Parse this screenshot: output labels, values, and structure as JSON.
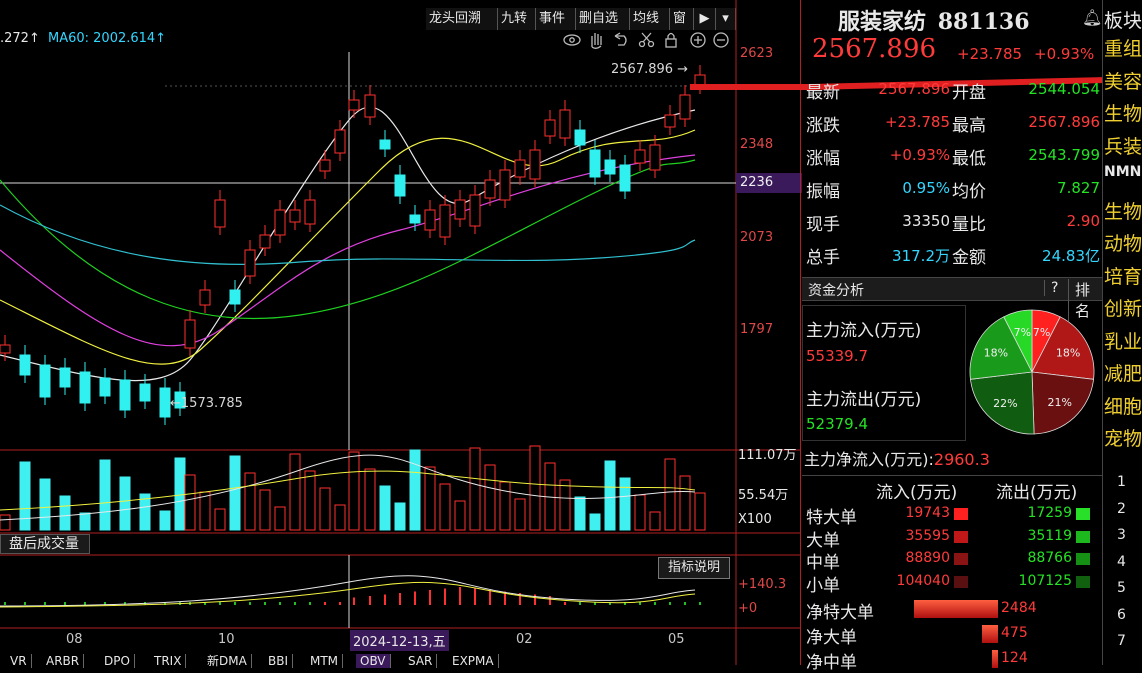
{
  "toolbar": {
    "buttons": [
      "龙头回溯",
      "九转",
      "事件",
      "删自选",
      "均线",
      "窗"
    ],
    "icons": [
      "eye-icon",
      "hand-icon",
      "undo-icon",
      "scissors-icon",
      "lock-icon",
      "zoom-in-icon",
      "zoom-out-icon"
    ]
  },
  "indicator_line": {
    "ma_prefix": ".272↑",
    "ma60": "MA60: 2002.614↑"
  },
  "price_axis": [
    "2623",
    "2348",
    "2236",
    "2073",
    "1797"
  ],
  "volume_axis": [
    "111.07万",
    "55.54万",
    "X100"
  ],
  "macd_axis": [
    "+140.3",
    "+0"
  ],
  "annotations": {
    "high": "2567.896",
    "low": "1573.785"
  },
  "panels": {
    "volume_title": "盘后成交量",
    "indicator_help": "指标说明"
  },
  "date_axis": [
    "08",
    "10",
    "2024-12-13,五",
    "02",
    "05"
  ],
  "bottom_tabs": [
    "VR",
    "ARBR",
    "DPO",
    "TRIX",
    "新DMA",
    "BBI",
    "MTM",
    "OBV",
    "SAR",
    "EXPMA"
  ],
  "quote": {
    "name": "服装家纺",
    "code": "881136",
    "price": "2567.896",
    "change": "+23.785",
    "change_pct": "+0.93%",
    "rows": [
      {
        "l1": "最新",
        "v1": "2567.896",
        "c1": "red",
        "l2": "开盘",
        "v2": "2544.054",
        "c2": "green"
      },
      {
        "l1": "涨跌",
        "v1": "+23.785",
        "c1": "red",
        "l2": "最高",
        "v2": "2567.896",
        "c2": "red"
      },
      {
        "l1": "涨幅",
        "v1": "+0.93%",
        "c1": "red",
        "l2": "最低",
        "v2": "2543.799",
        "c2": "green"
      },
      {
        "l1": "振幅",
        "v1": "0.95%",
        "c1": "cyan",
        "l2": "均价",
        "v2": "7.827",
        "c2": "green"
      },
      {
        "l1": "现手",
        "v1": "33350",
        "c1": "white",
        "l2": "量比",
        "v2": "2.90",
        "c2": "red"
      },
      {
        "l1": "总手",
        "v1": "317.2万",
        "c1": "cyan",
        "l2": "金额",
        "v2": "24.83亿",
        "c2": "cyan"
      }
    ]
  },
  "capital": {
    "title": "资金分析",
    "help": "?",
    "rank": "排名",
    "inflow_label": "主力流入(万元)",
    "inflow_value": "55339.7",
    "outflow_label": "主力流出(万元)",
    "outflow_value": "52379.4",
    "net_label": "主力净流入(万元):",
    "net_value": "2960.3",
    "pie": [
      {
        "label": "7%",
        "value": 7,
        "color": "#ff2020"
      },
      {
        "label": "18%",
        "value": 18,
        "color": "#b01818"
      },
      {
        "label": "21%",
        "value": 21,
        "color": "#6a1010"
      },
      {
        "label": "22%",
        "value": 22,
        "color": "#105c10"
      },
      {
        "label": "18%",
        "value": 18,
        "color": "#1a9a1a"
      },
      {
        "label": "7%",
        "value": 7,
        "color": "#27d827"
      }
    ],
    "flow_header": [
      "流入(万元)",
      "流出(万元)"
    ],
    "flows": [
      {
        "name": "特大单",
        "in": "19743",
        "out": "17259"
      },
      {
        "name": "大单",
        "in": "35595",
        "out": "35119"
      },
      {
        "name": "中单",
        "in": "88890",
        "out": "88766"
      },
      {
        "name": "小单",
        "in": "104040",
        "out": "107125"
      }
    ],
    "net": [
      {
        "name": "净特大单",
        "value": "2484",
        "amount": 2484
      },
      {
        "name": "净大单",
        "value": "475",
        "amount": 475
      },
      {
        "name": "净中单",
        "value": "124",
        "amount": 124
      }
    ]
  },
  "side_list": {
    "header": "板块",
    "items": [
      "重组",
      "美容",
      "生物",
      "兵装",
      "NMN",
      "生物",
      "动物",
      "培育",
      "创新",
      "乳业",
      "减肥",
      "细胞",
      "宠物"
    ],
    "numbers": [
      "1",
      "2",
      "3",
      "4",
      "5",
      "6",
      "7"
    ]
  }
}
